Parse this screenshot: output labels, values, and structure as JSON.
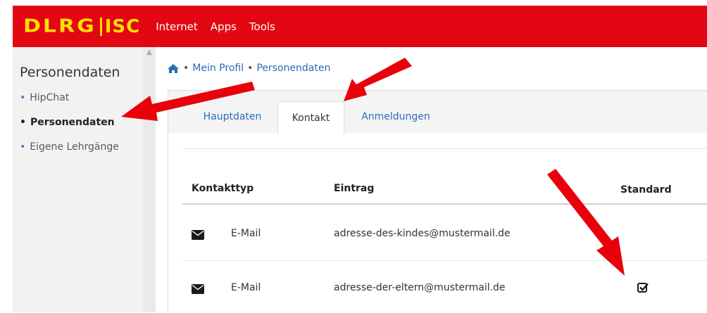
{
  "brand": {
    "logo": "DLRG",
    "suffix": "ISC"
  },
  "nav": {
    "items": [
      "Internet",
      "Apps",
      "Tools"
    ]
  },
  "sidebar": {
    "title": "Personendaten",
    "items": [
      {
        "label": "HipChat",
        "active": false
      },
      {
        "label": "Personendaten",
        "active": true
      },
      {
        "label": "Eigene Lehrgänge",
        "active": false
      }
    ]
  },
  "breadcrumb": {
    "home_icon": "home-icon",
    "separator": "•",
    "items": [
      "Mein Profil",
      "Personendaten"
    ]
  },
  "tabs": [
    {
      "label": "Hauptdaten",
      "active": false
    },
    {
      "label": "Kontakt",
      "active": true
    },
    {
      "label": "Anmeldungen",
      "active": false
    }
  ],
  "table": {
    "headers": [
      "Kontakttyp",
      "Eintrag",
      "Standard"
    ],
    "rows": [
      {
        "icon": "envelope-icon",
        "type": "E-Mail",
        "entry": "adresse-des-kindes@mustermail.de",
        "standard": false
      },
      {
        "icon": "envelope-icon",
        "type": "E-Mail",
        "entry": "adresse-der-eltern@mustermail.de",
        "standard": true
      }
    ]
  },
  "colors": {
    "navbar": "#e30613",
    "logo": "#ffe000",
    "link": "#2a6db5",
    "annotation_arrow": "#e8000b"
  }
}
